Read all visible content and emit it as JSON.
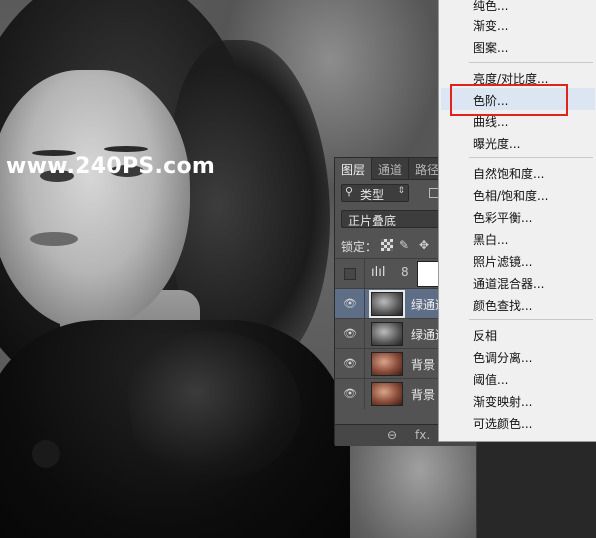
{
  "watermark": "www.240PS.com",
  "layers_panel": {
    "tabs": [
      "图层",
      "通道",
      "路径"
    ],
    "filter": {
      "icon": "search-icon",
      "kind_label": "类型"
    },
    "blend_mode": "正片叠底",
    "lock_label": "锁定：",
    "layers": [
      {
        "name": "",
        "type": "adjustment",
        "visible": false,
        "selected": false
      },
      {
        "name": "绿通道",
        "type": "gray",
        "visible": true,
        "selected": true
      },
      {
        "name": "绿通道",
        "type": "gray",
        "visible": true,
        "selected": false
      },
      {
        "name": "背景",
        "type": "color",
        "visible": true,
        "selected": false
      },
      {
        "name": "背景",
        "type": "color",
        "visible": true,
        "selected": false
      }
    ],
    "bottom_icons": [
      "link-icon",
      "fx-icon"
    ],
    "fx_label": "fx."
  },
  "adjustment_menu": {
    "items": [
      "纯色...",
      "渐变...",
      "图案...",
      "亮度/对比度...",
      "色阶...",
      "曲线...",
      "曝光度...",
      "自然饱和度...",
      "色相/饱和度...",
      "色彩平衡...",
      "黑白...",
      "照片滤镜...",
      "通道混合器...",
      "颜色查找...",
      "反相",
      "色调分离...",
      "阈值...",
      "渐变映射...",
      "可选颜色..."
    ],
    "highlighted": "色阶...",
    "highlight_color": "#e2231a"
  }
}
